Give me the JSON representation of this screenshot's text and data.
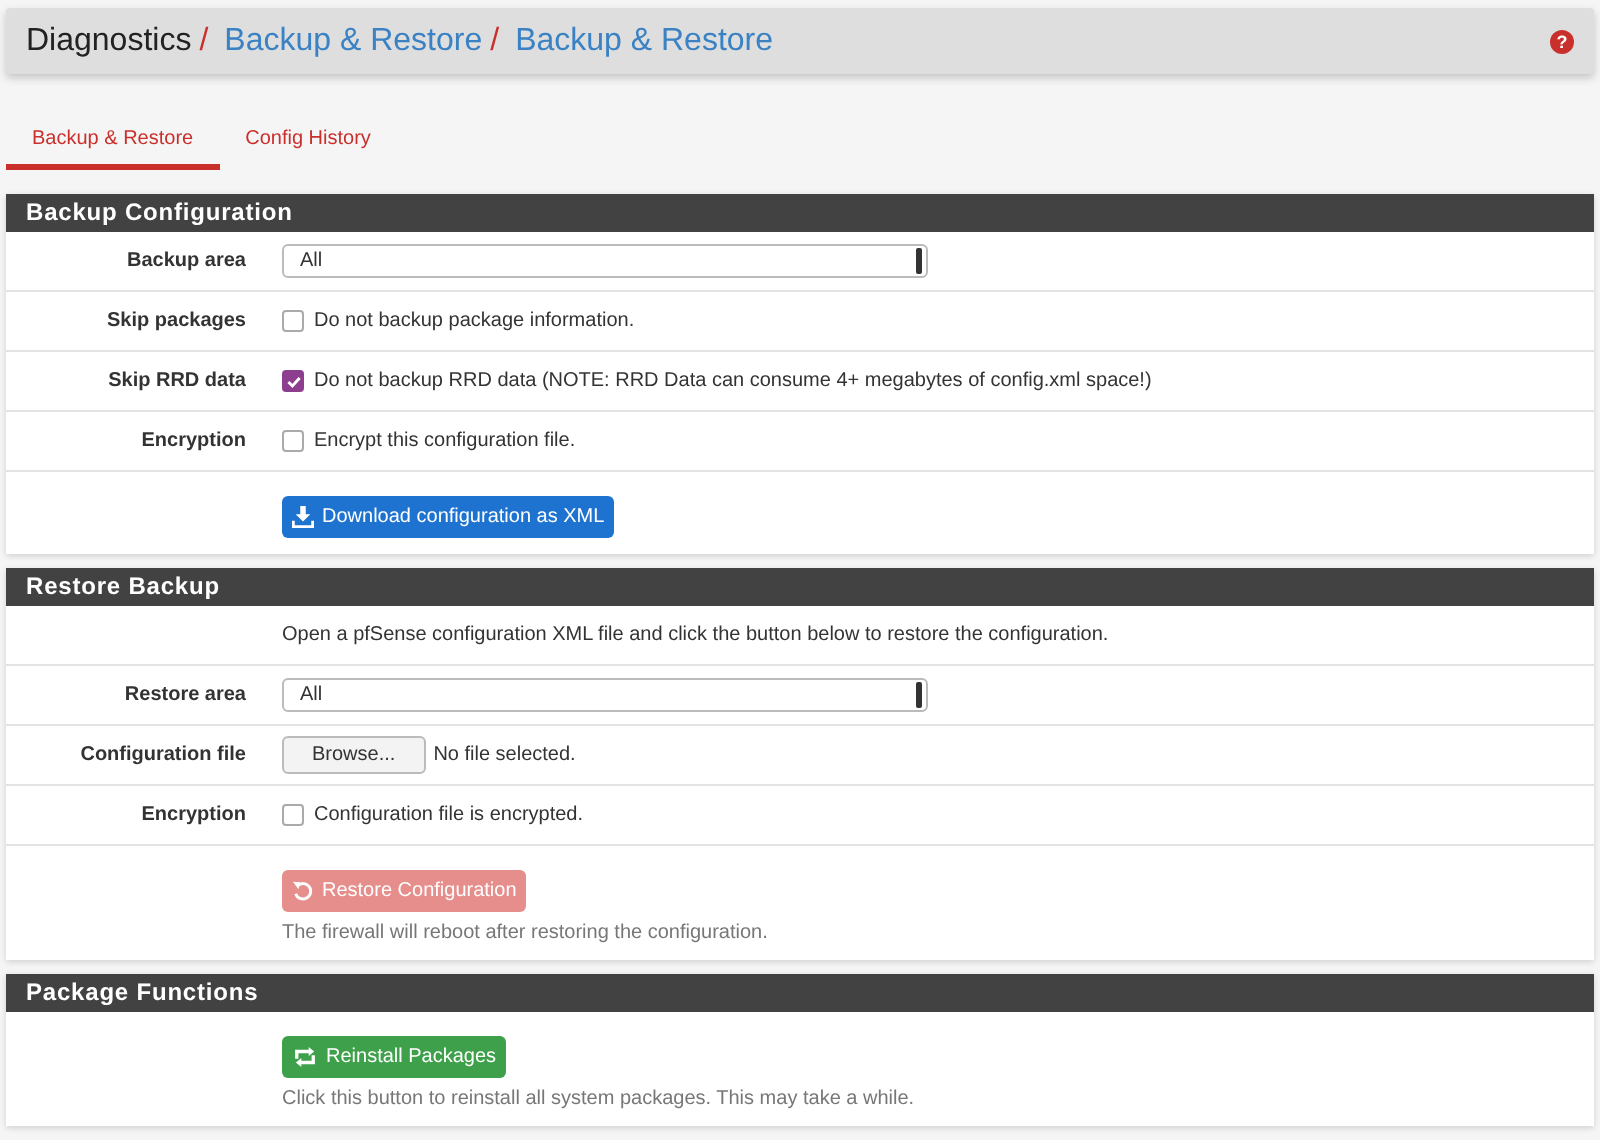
{
  "breadcrumb": [
    {
      "text": "Diagnostics",
      "link": false,
      "separator": "/"
    },
    {
      "text": "Backup & Restore",
      "link": true,
      "separator": "/"
    },
    {
      "text": "Backup & Restore",
      "link": true
    }
  ],
  "help": "?",
  "tabs": [
    {
      "label": "Backup & Restore",
      "selected": true
    },
    {
      "label": "Config History",
      "selected": false
    }
  ],
  "sections": [
    {
      "title": "Backup Configuration",
      "rows": [
        {
          "kind": "select",
          "label": "Backup area",
          "value": "All"
        },
        {
          "kind": "checkbox",
          "label": "Skip packages",
          "text": "Do not backup package information.",
          "checked": false
        },
        {
          "kind": "checkbox",
          "label": "Skip RRD data",
          "text": "Do not backup RRD data (NOTE: RRD Data can consume 4+ megabytes of config.xml space!)",
          "checked": true
        },
        {
          "kind": "checkbox",
          "label": "Encryption",
          "text": "Encrypt this configuration file.",
          "checked": false
        },
        {
          "kind": "button",
          "text": "Download configuration as XML",
          "disabled": false
        }
      ]
    },
    {
      "title": "Restore Backup",
      "rows": [
        {
          "kind": "text",
          "text": "Open a pfSense configuration XML file and click the button below to restore the configuration."
        },
        {
          "kind": "select",
          "label": "Restore area",
          "value": "All"
        },
        {
          "kind": "file",
          "label": "Configuration file",
          "button": "Browse...",
          "status": "No file selected."
        },
        {
          "kind": "checkbox",
          "label": "Encryption",
          "text": "Configuration file is encrypted.",
          "checked": false
        },
        {
          "kind": "button",
          "text": "Restore Configuration",
          "disabled": true,
          "note": "The firewall will reboot after restoring the configuration."
        }
      ]
    },
    {
      "title": "Package Functions",
      "rows": [
        {
          "kind": "button",
          "text": "Reinstall Packages",
          "disabled": false,
          "note": "Click this button to reinstall all system packages. This may take a while."
        }
      ]
    }
  ]
}
